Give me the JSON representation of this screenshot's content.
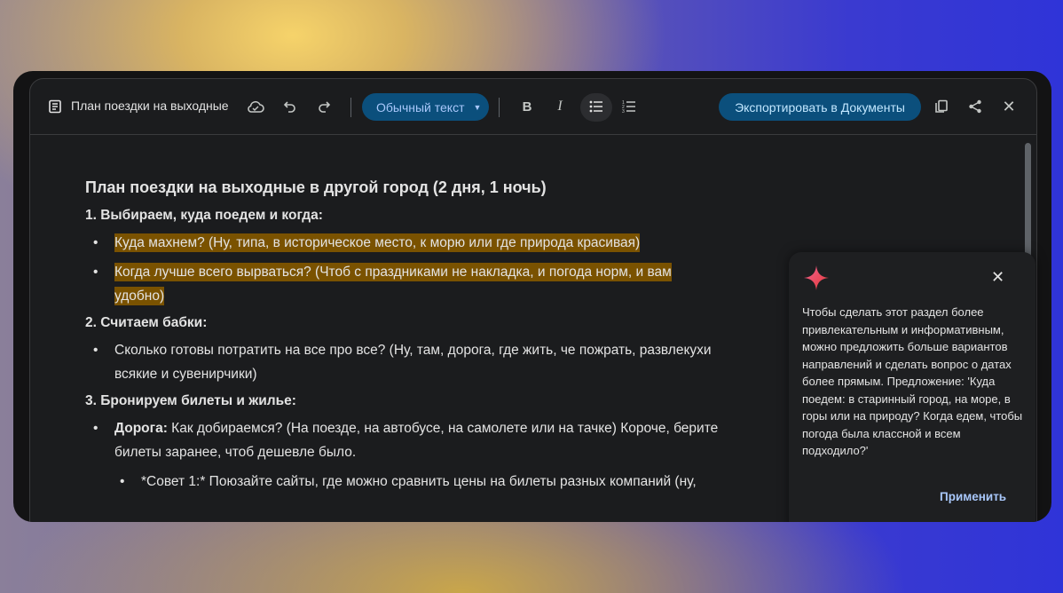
{
  "toolbar": {
    "doc_title": "План поездки на выходные",
    "text_style": "Обычный текст",
    "export_label": "Экспортировать в Документы",
    "icons": [
      "document-icon",
      "cloud-saved-icon",
      "undo-icon",
      "redo-icon",
      "bold-icon",
      "italic-icon",
      "bulleted-list-icon",
      "numbered-list-icon",
      "copy-icon",
      "share-icon",
      "close-icon"
    ]
  },
  "document": {
    "title": "План поездки на выходные в другой город (2 дня, 1 ночь)",
    "s1": "1. Выбираем, куда поедем и когда:",
    "s1_items": [
      "Куда махнем? (Ну, типа, в историческое место, к морю или где природа красивая)",
      "Когда лучше всего вырваться? (Чтоб с праздниками не накладка, и погода норм, и вам удобно)"
    ],
    "s2": "2. Считаем бабки:",
    "s2_items": [
      "Сколько готовы потратить на все про все? (Ну, там, дорога, где жить, че пожрать, развлекухи всякие и сувенирчики)"
    ],
    "s3": "3. Бронируем билеты и жилье:",
    "s3_item_bold": "Дорога:",
    "s3_item_text": " Как добираемся? (На поезде, на автобусе, на самолете или на тачке) Короче, берите билеты заранее, чтоб дешевле было.",
    "s3_sub": "*Совет 1:* Поюзайте сайты, где можно сравнить цены на билеты разных компаний (ну,",
    "highlight_color": "#7a5200"
  },
  "suggestion": {
    "text": "Чтобы сделать этот раздел более привлекательным и информативным, можно предложить больше вариантов направлений и сделать вопрос о датах более прямым. Предложение: 'Куда поедем: в старинный город, на море, в горы или на природу? Когда едем, чтобы погода была классной и всем подходило?'",
    "apply_label": "Применить",
    "close": "✕"
  }
}
